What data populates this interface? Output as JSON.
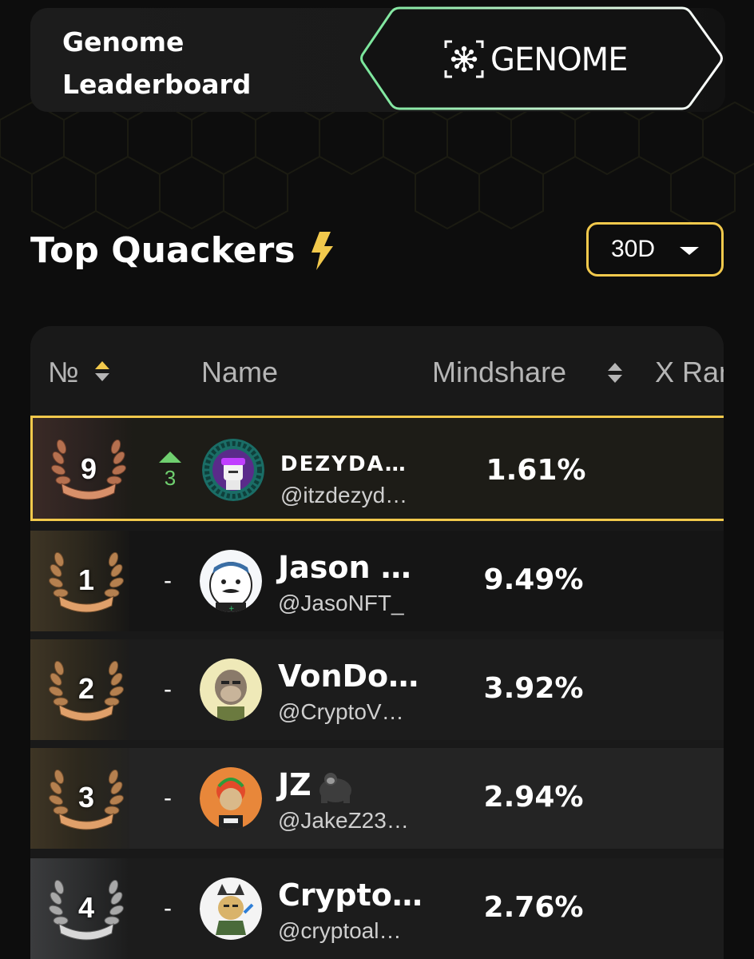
{
  "header": {
    "title": "Genome\nLeaderboard",
    "brand": "GENOME",
    "brand_icon": "genome-logo-icon"
  },
  "section": {
    "title": "Top Quackers",
    "icon": "lightning-bolt-icon",
    "period_selected": "30D"
  },
  "colors": {
    "accent_gold": "#f2c94c",
    "accent_green": "#6fcf6f",
    "badge_border_green": "#7ae69b"
  },
  "table": {
    "columns": {
      "rank": "№",
      "name": "Name",
      "mindshare": "Mindshare",
      "x_rank": "X Ran"
    },
    "rows": [
      {
        "rank": "9",
        "medal": "bronze",
        "change": "3",
        "change_dir": "up",
        "name": "DEZYDA…",
        "handle": "@itzdezyd…",
        "mindshare": "1.61%",
        "highlighted": true
      },
      {
        "rank": "1",
        "medal": "bronze",
        "change": "-",
        "change_dir": "none",
        "name": "Jason …",
        "handle": "@JasoNFT_",
        "mindshare": "9.49%"
      },
      {
        "rank": "2",
        "medal": "bronze",
        "change": "-",
        "change_dir": "none",
        "name": "VonDo…",
        "handle": "@CryptoV…",
        "mindshare": "3.92%"
      },
      {
        "rank": "3",
        "medal": "bronze",
        "change": "-",
        "change_dir": "none",
        "name": "JZ",
        "name_emoji": "gorilla-icon",
        "handle": "@JakeZ23…",
        "mindshare": "2.94%"
      },
      {
        "rank": "4",
        "medal": "silver",
        "change": "-",
        "change_dir": "none",
        "name": "Crypto…",
        "handle": "@cryptoal…",
        "mindshare": "2.76%"
      }
    ]
  }
}
